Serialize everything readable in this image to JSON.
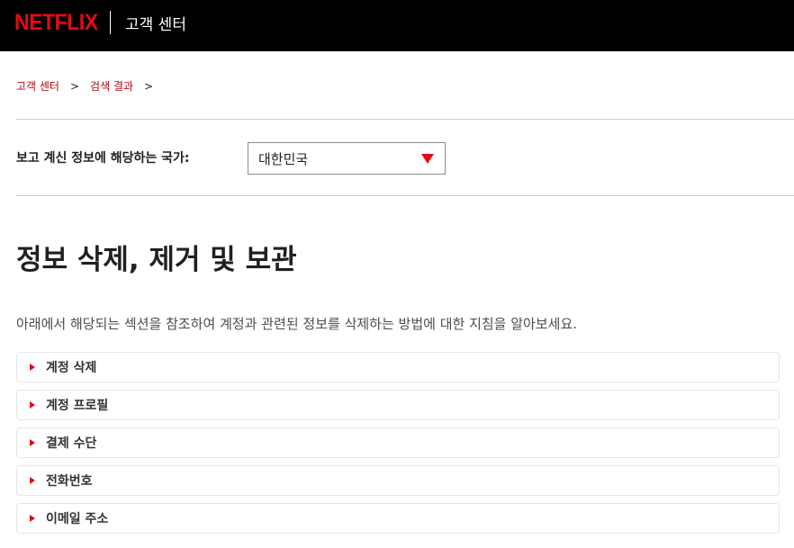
{
  "header": {
    "logo_text": "NETFLIX",
    "title": "고객 센터",
    "logo_color": "#e50914",
    "background": "#000000"
  },
  "breadcrumb": {
    "items": [
      "고객 센터",
      "검색 결과"
    ],
    "separator": ">"
  },
  "country": {
    "label": "보고 계신 정보에 해당하는 국가:",
    "selected": "대한민국"
  },
  "main": {
    "title": "정보 삭제, 제거 및 보관",
    "intro": "아래에서 해당되는 섹션을 참조하여 계정과 관련된 정보를 삭제하는 방법에 대한 지침을 알아보세요."
  },
  "sections": [
    {
      "label": "계정 삭제"
    },
    {
      "label": "계정 프로필"
    },
    {
      "label": "결제 수단"
    },
    {
      "label": "전화번호"
    },
    {
      "label": "이메일 주소"
    }
  ],
  "colors": {
    "accent": "#e50914",
    "link": "#b20710",
    "text": "#221f1f"
  }
}
